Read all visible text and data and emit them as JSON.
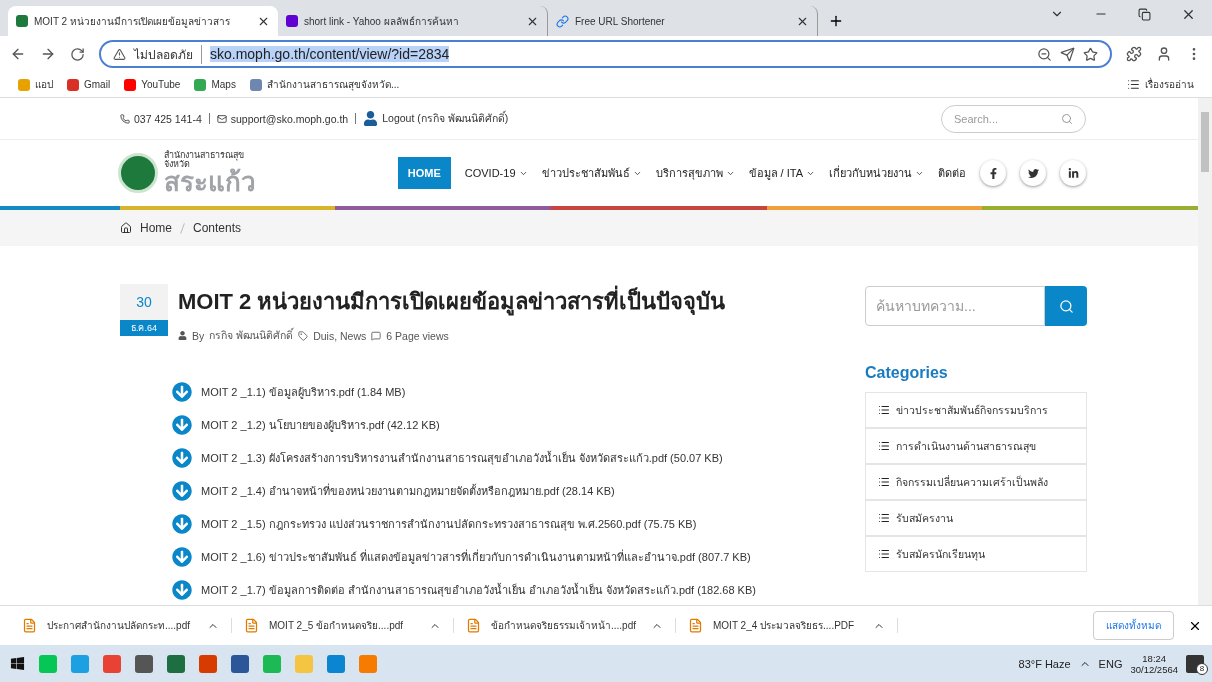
{
  "browser": {
    "tabs": [
      {
        "title": "MOIT 2 หน่วยงานมีการเปิดเผยข้อมูลข่าวสาร",
        "selected": true,
        "kind": "site"
      },
      {
        "title": "short link - Yahoo ผลลัพธ์การค้นหา",
        "selected": false,
        "kind": "yahoo"
      },
      {
        "title": "Free URL Shortener",
        "selected": false,
        "kind": "link"
      }
    ],
    "address": {
      "security_label": "ไม่ปลอดภัย",
      "url": "sko.moph.go.th/content/view/?id=2834"
    },
    "bookmarks": [
      {
        "label": "แอป",
        "kind": "apps"
      },
      {
        "label": "Gmail",
        "kind": "gmail"
      },
      {
        "label": "YouTube",
        "kind": "youtube"
      },
      {
        "label": "Maps",
        "kind": "maps"
      },
      {
        "label": "สำนักงานสาธารณสุขจังหวัด...",
        "kind": "people"
      }
    ],
    "reading_list": "เรื่องรออ่าน"
  },
  "page": {
    "topbar": {
      "phone": "037 425 141-4",
      "email": "support@sko.moph.go.th",
      "logout": "Logout (กรกิจ พัฒนนิติศักดิ์)",
      "search_placeholder": "Search..."
    },
    "logo": {
      "line1": "สำนักงานสาธารณสุข",
      "line2": "จังหวัด",
      "line3": "สระแก้ว"
    },
    "nav": [
      {
        "label": "HOME",
        "dropdown": false,
        "selected": true
      },
      {
        "label": "COVID-19",
        "dropdown": true,
        "selected": false
      },
      {
        "label": "ข่าวประชาสัมพันธ์",
        "dropdown": true,
        "selected": false
      },
      {
        "label": "บริการสุขภาพ",
        "dropdown": true,
        "selected": false
      },
      {
        "label": "ข้อมูล / ITA",
        "dropdown": true,
        "selected": false
      },
      {
        "label": "เกี่ยวกับหน่วยงาน",
        "dropdown": true,
        "selected": false
      },
      {
        "label": "ติดต่อ",
        "dropdown": false,
        "selected": false
      }
    ],
    "social": [
      {
        "kind": "facebook"
      },
      {
        "kind": "twitter"
      },
      {
        "kind": "linkedin"
      }
    ],
    "breadcrumb": [
      "Home",
      "Contents"
    ],
    "article": {
      "day": "30",
      "month": "ธ.ค.64",
      "title": "MOIT 2 หน่วยงานมีการเปิดเผยข้อมูลข่าวสารที่เป็นปัจจุบัน",
      "by": "By",
      "author": "กรกิจ พัฒนนิติศักดิ์",
      "tags": "Duis, News",
      "views": "6 Page views",
      "files": [
        "MOIT 2 _1.1) ข้อมูลผู้บริหาร.pdf (1.84 MB)",
        "MOIT 2 _1.2) นโยบายของผู้บริหาร.pdf (42.12 KB)",
        "MOIT 2 _1.3) ผังโครงสร้างการบริหารงานสำนักงานสาธารณสุขอำเภอวังน้ำเย็น จังหวัดสระแก้ว.pdf (50.07 KB)",
        "MOIT 2 _1.4) อำนาจหน้าที่ของหน่วยงานตามกฎหมายจัดตั้งหรือกฎหมาย.pdf (28.14 KB)",
        "MOIT 2 _1.5) กฎกระทรวง แบ่งส่วนราชการสำนักงานปลัดกระทรวงสาธารณสุข พ.ศ.2560.pdf (75.75 KB)",
        "MOIT 2 _1.6) ข่าวประชาสัมพันธ์ ที่แสดงข้อมูลข่าวสารที่เกี่ยวกับการดำเนินงานตามหน้าที่และอำนาจ.pdf (807.7 KB)",
        "MOIT 2 _1.7) ข้อมูลการติดต่อ สำนักงานสาธารณสุขอำเภอวังน้ำเย็น อำเภอวังน้ำเย็น จังหวัดสระแก้ว.pdf (182.68 KB)"
      ]
    },
    "sidebar": {
      "search_placeholder": "ค้นหาบทความ...",
      "categories_title": "Categories",
      "categories": [
        "ข่าวประชาสัมพันธ์กิจกรรมบริการ",
        "การดำเนินงานด้านสาธารณสุข",
        "กิจกรรมเปลี่ยนความเศร้าเป็นพลัง",
        "รับสมัครงาน",
        "รับสมัครนักเรียนทุน"
      ]
    }
  },
  "downloads": {
    "items": [
      "ประกาศสำนักงานปลัดกระท....pdf",
      "MOIT 2_5 ข้อกำหนดจริย....pdf",
      "ข้อกำหนดจริยธรรมเจ้าหน้า....pdf",
      "MOIT 2_4 ประมวลจริยธร....PDF"
    ],
    "show_all": "แสดงทั้งหมด"
  },
  "taskbar": {
    "apps": [
      {
        "kind": "line"
      },
      {
        "kind": "ie"
      },
      {
        "kind": "chrome"
      },
      {
        "kind": "calculator"
      },
      {
        "kind": "excel"
      },
      {
        "kind": "office"
      },
      {
        "kind": "word"
      },
      {
        "kind": "spotify"
      },
      {
        "kind": "explorer"
      },
      {
        "kind": "edge"
      },
      {
        "kind": "orange"
      }
    ],
    "weather": "83°F Haze",
    "language": "ENG",
    "time": "18:24",
    "date": "30/12/2564",
    "notifications": "8"
  }
}
